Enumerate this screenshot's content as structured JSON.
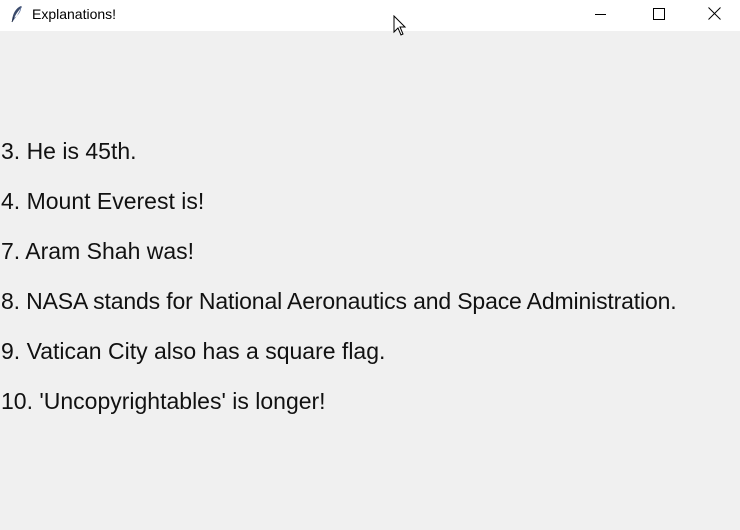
{
  "window": {
    "title": "Explanations!",
    "app_icon": "feather-icon",
    "controls": [
      "minimize-icon",
      "maximize-icon",
      "close-icon"
    ]
  },
  "explanations": [
    "3. He is 45th.",
    "4. Mount Everest is!",
    "7. Aram Shah was!",
    "8. NASA stands for National Aeronautics and Space Administration.",
    "9. Vatican City also has a square flag.",
    "10. 'Uncopyrightables' is longer!"
  ],
  "colors": {
    "titlebar_bg": "#ffffff",
    "window_bg": "#f0f0f0",
    "text": "#111111"
  }
}
